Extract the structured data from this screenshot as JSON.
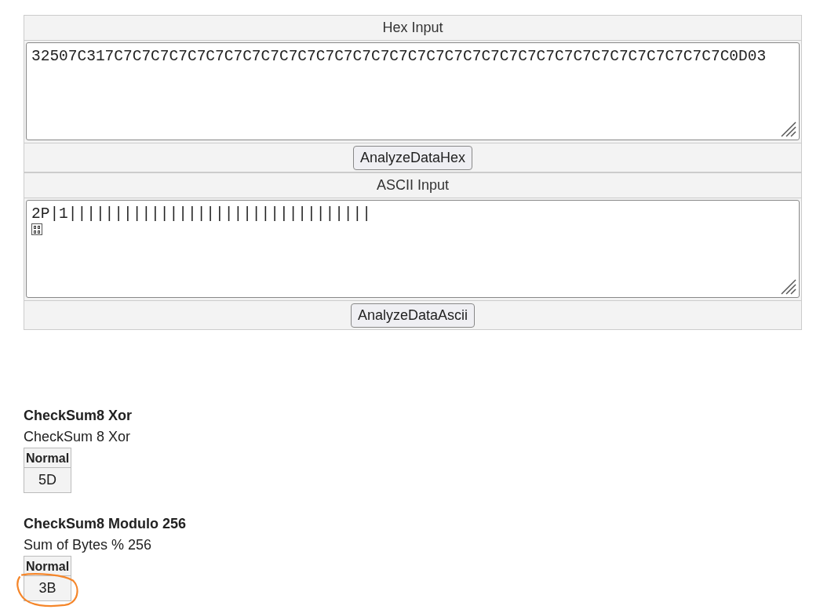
{
  "inputs": [
    {
      "title": "Hex Input",
      "value": "32507C317C7C7C7C7C7C7C7C7C7C7C7C7C7C7C7C7C7C7C7C7C7C7C7C7C7C7C7C7C7C7C7C7C7C0D03",
      "control_char": false,
      "button": "AnalyzeDataHex"
    },
    {
      "title": "ASCII Input",
      "value": "2P|1|||||||||||||||||||||||||||||||||",
      "control_char": true,
      "button": "AnalyzeDataAscii"
    }
  ],
  "results": [
    {
      "title": "CheckSum8 Xor",
      "description": "CheckSum 8 Xor",
      "column": "Normal",
      "value": "5D",
      "circled": false
    },
    {
      "title": "CheckSum8 Modulo 256",
      "description": "Sum of Bytes % 256",
      "column": "Normal",
      "value": "3B",
      "circled": true
    }
  ]
}
